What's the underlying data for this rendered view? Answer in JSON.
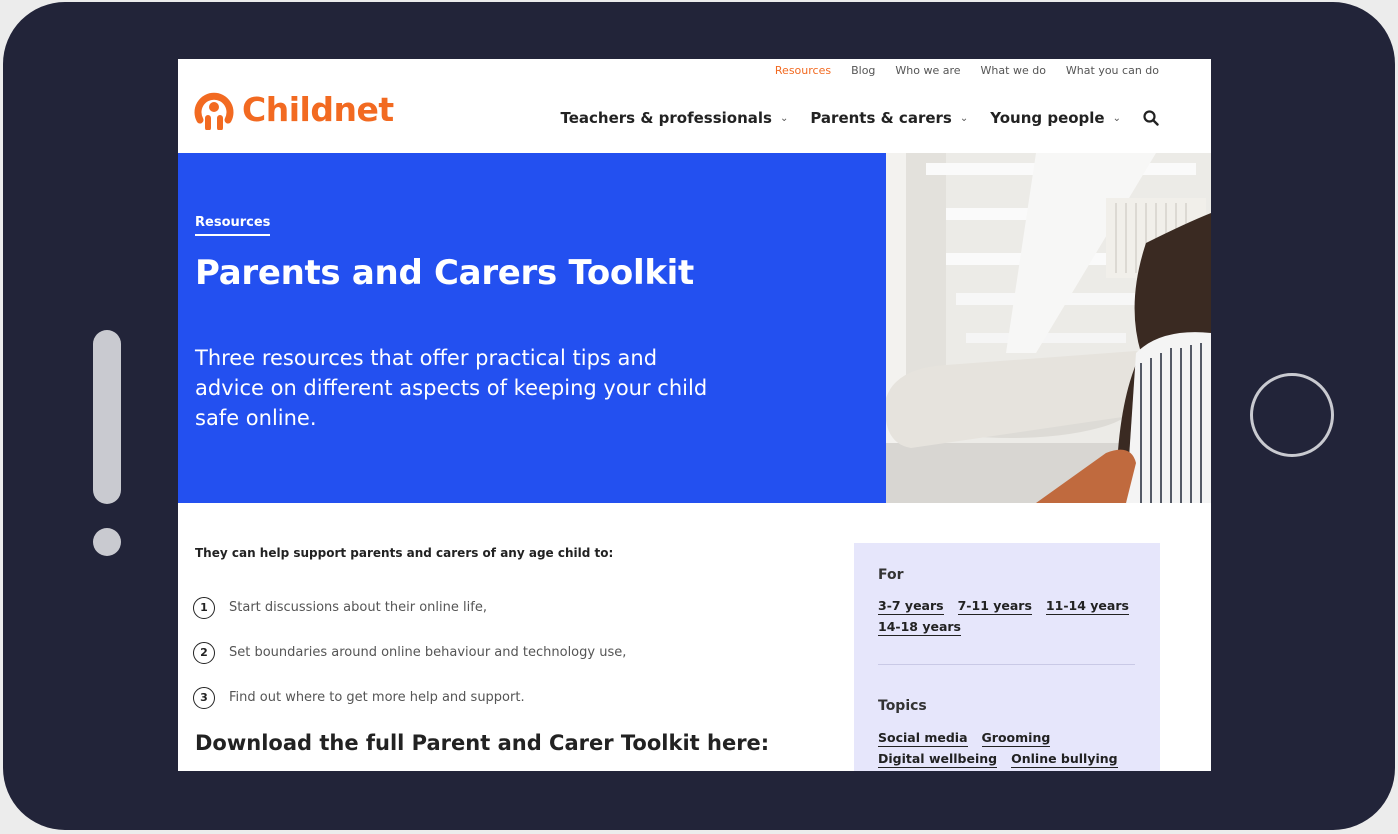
{
  "brand": {
    "name": "Childnet",
    "color": "#f26a21"
  },
  "util_nav": [
    {
      "label": "Resources",
      "active": true
    },
    {
      "label": "Blog",
      "active": false
    },
    {
      "label": "Who we are",
      "active": false
    },
    {
      "label": "What we do",
      "active": false
    },
    {
      "label": "What you can do",
      "active": false
    }
  ],
  "main_nav": [
    {
      "label": "Teachers & professionals"
    },
    {
      "label": "Parents & carers"
    },
    {
      "label": "Young people"
    }
  ],
  "icons": {
    "search": "search-icon",
    "chevron": "chevron-down-icon"
  },
  "hero": {
    "breadcrumb": "Resources",
    "title": "Parents and Carers Toolkit",
    "subtitle": "Three resources that offer practical tips and advice on different aspects of keeping your child safe online.",
    "color": "#2350f0"
  },
  "content": {
    "intro": "They can help support parents and carers of any age child to:",
    "steps": [
      {
        "number": "1",
        "text": "Start discussions about their online life,"
      },
      {
        "number": "2",
        "text": "Set boundaries around online behaviour and technology use,"
      },
      {
        "number": "3",
        "text": "Find out where to get more help and support."
      }
    ],
    "download_heading": "Download the full Parent and Carer Toolkit here:"
  },
  "sidebar": {
    "for_label": "For",
    "ages": [
      "3-7 years",
      "7-11 years",
      "11-14 years",
      "14-18 years"
    ],
    "topics_label": "Topics",
    "topics": [
      "Social media",
      "Grooming",
      "Digital wellbeing",
      "Online bullying"
    ],
    "background": "#e6e6fb"
  }
}
